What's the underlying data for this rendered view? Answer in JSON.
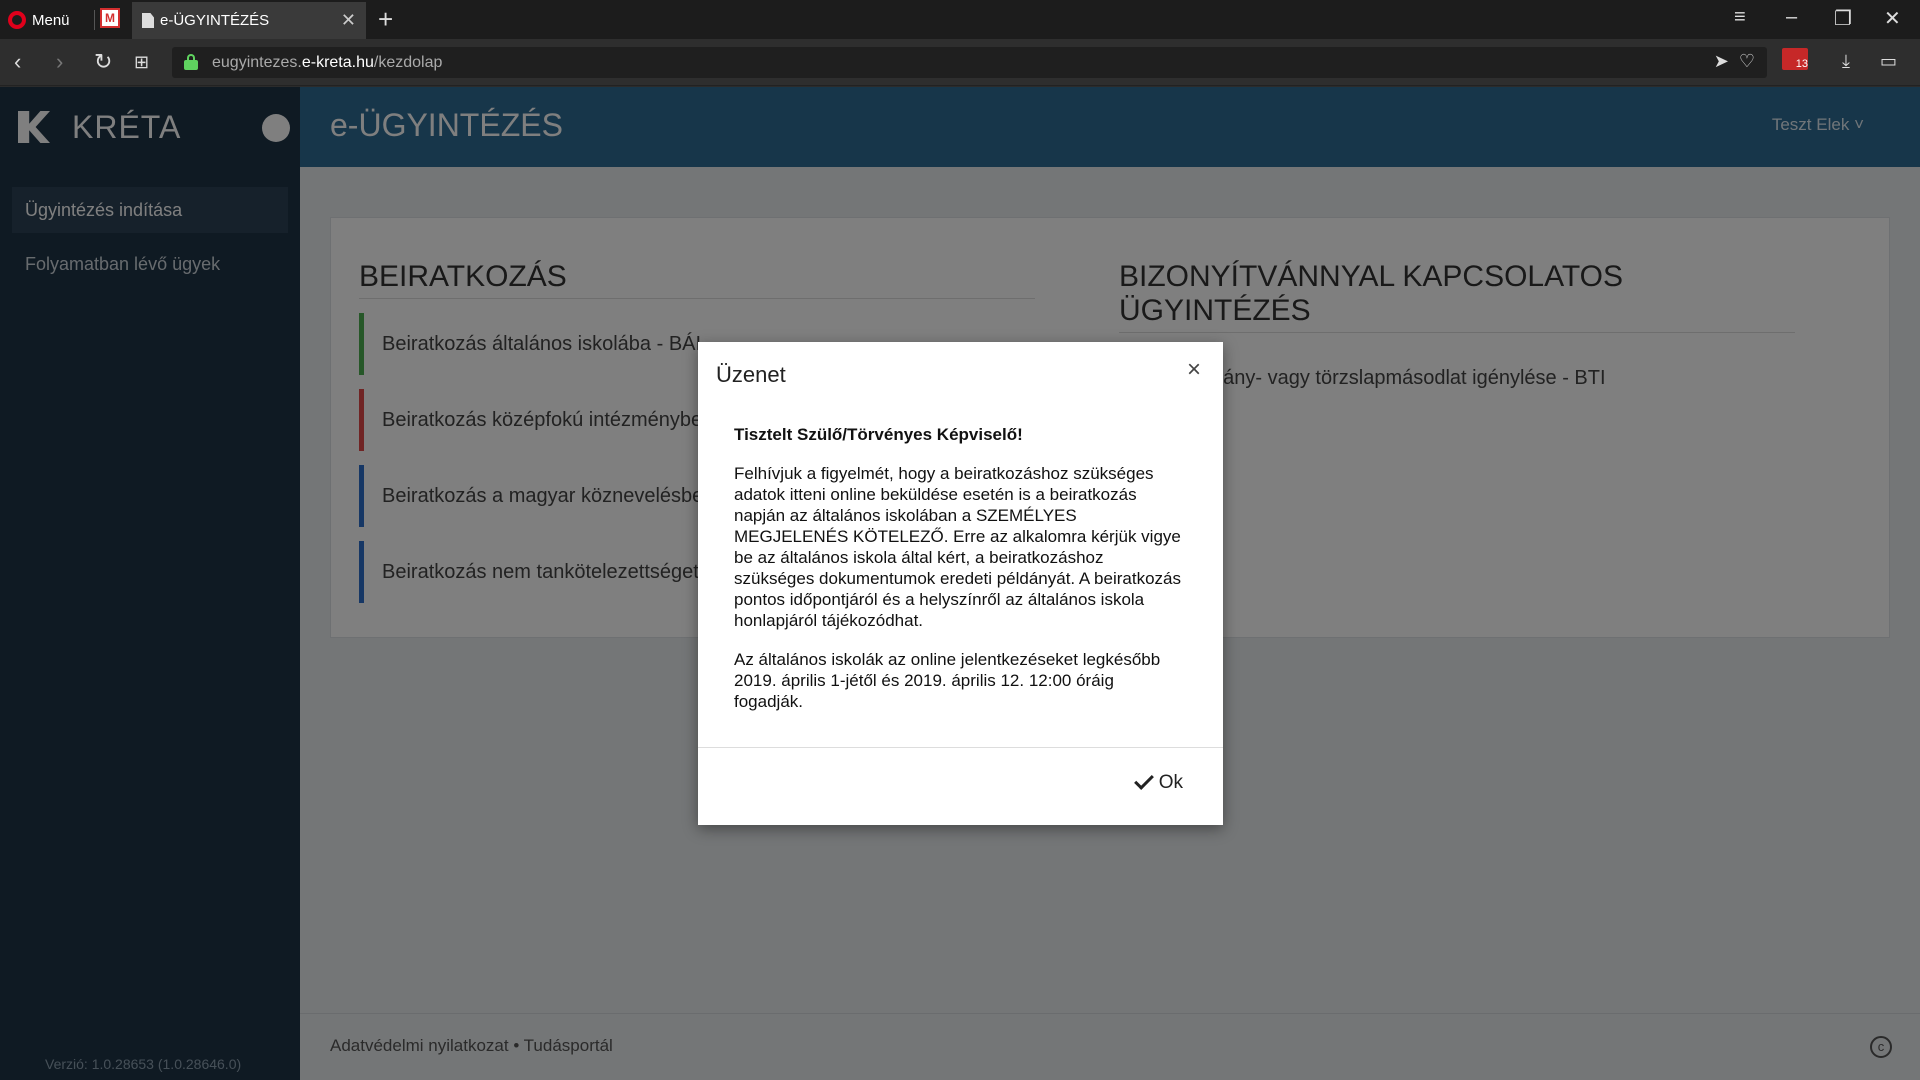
{
  "browser": {
    "menu_label": "Menü",
    "tab_title": "e-ÜGYINTÉZÉS",
    "url_prefix": "eugyintezes.",
    "url_host": "e-kreta.hu",
    "url_path": "/kezdolap",
    "badge_count": "13"
  },
  "sidebar": {
    "logo_text": "KRÉTA",
    "items": [
      {
        "label": "Ügyintézés indítása"
      },
      {
        "label": "Folyamatban lévő ügyek"
      }
    ],
    "version": "Verzió: 1.0.28653 (1.0.28646.0)"
  },
  "header": {
    "title": "e-ÜGYINTÉZÉS",
    "user": "Teszt Elek"
  },
  "main": {
    "left_heading": "BEIRATKOZÁS",
    "left_items": [
      {
        "label": "Beiratkozás általános iskolába - BÁI"
      },
      {
        "label": "Beiratkozás középfokú intézménybe"
      },
      {
        "label": "Beiratkozás a magyar köznevelésbe"
      },
      {
        "label": "Beiratkozás nem tankötelezettséget"
      }
    ],
    "right_heading": "BIZONYÍTVÁNNYAL KAPCSOLATOS ÜGYINTÉZÉS",
    "right_items": [
      {
        "label": "Bizonyítvány- vagy törzslapmásodlat igénylése - BTI"
      }
    ]
  },
  "footer": {
    "links": "Adatvédelmi nyilatkozat • Tudásportál",
    "copyright_symbol": "c"
  },
  "modal": {
    "title": "Üzenet",
    "greeting": "Tisztelt Szülő/Törvényes Képviselő!",
    "paragraph1": "Felhívjuk a figyelmét, hogy a beiratkozáshoz szükséges adatok itteni online beküldése esetén is a beiratkozás napján az általános iskolában a SZEMÉLYES MEGJELENÉS KÖTELEZŐ. Erre az alkalomra kérjük vigye be az általános iskola által kért, a beiratkozáshoz szükséges dokumentumok eredeti példányát. A beiratkozás pontos időpontjáról és a helyszínről az általános iskola honlapjáról tájékozódhat.",
    "paragraph2": "Az általános iskolák az online jelentkezéseket legkésőbb 2019. április 1-jétől és 2019. április 12. 12:00 óráig fogadják.",
    "ok_label": "Ok"
  }
}
